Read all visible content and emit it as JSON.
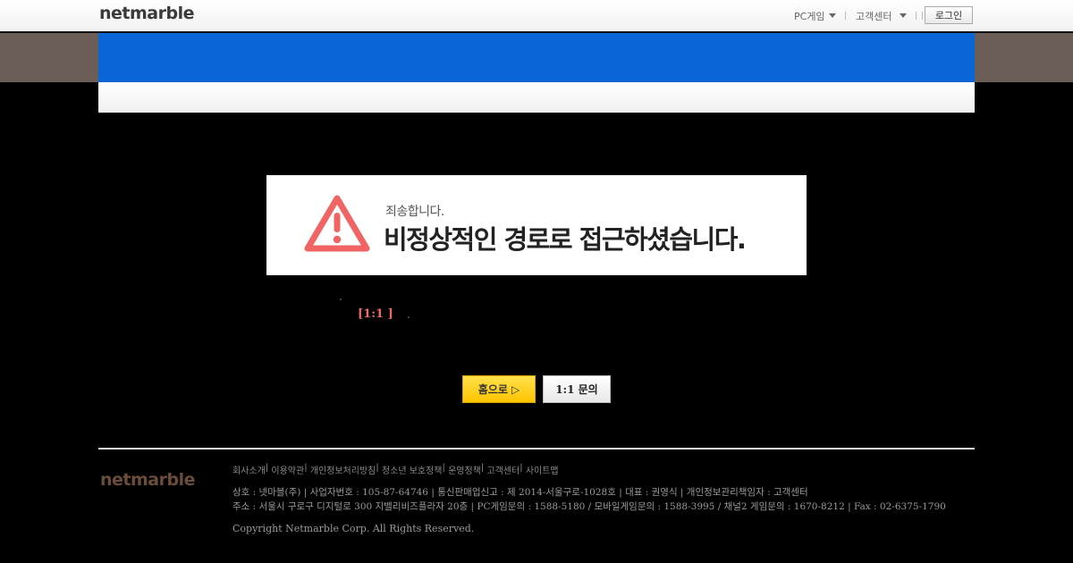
{
  "header": {
    "logo": "netmarble",
    "pc_menu_label": "PC게임",
    "customer_menu_label": "고객센터",
    "login_label": "로그인"
  },
  "error": {
    "sub": "죄송합니다.",
    "main": "비정상적인 경로로 접근하셨습니다.",
    "icon": "warning-triangle-icon",
    "icon_color": "#f06464"
  },
  "message": {
    "highlight": "[1:1 ]"
  },
  "buttons": {
    "home": "홈으로 ▷",
    "inquiry": "1:1 문의"
  },
  "footer": {
    "logo": "netmarble",
    "links": [
      "회사소개",
      "이용약관",
      "개인정보처리방침",
      "청소년 보호정책",
      "운영정책",
      "고객센터",
      "사이트맵"
    ],
    "info_line1": "상호 : 넷마블(주) | 사업자번호 : 105-87-64746 | 통신판매업신고 : 제 2014-서울구로-1028호 | 대표 : 권영식 | 개인정보관리책임자 : 고객센터",
    "info_line2": "주소 : 서울시 구로구 디지털로 300 지밸리비즈플라자 20층 | PC게임문의 : 1588-5180 / 모바일게임문의 : 1588-3995 / 채널2 게임문의 : 1670-8212 | Fax : 02-6375-1790",
    "copyright": "Copyright  Netmarble Corp. All Rights Reserved."
  },
  "colors": {
    "gnb_blue": "#0a66d6",
    "accent_yellow": "#ffc400",
    "highlight_red": "#f06a6a"
  }
}
